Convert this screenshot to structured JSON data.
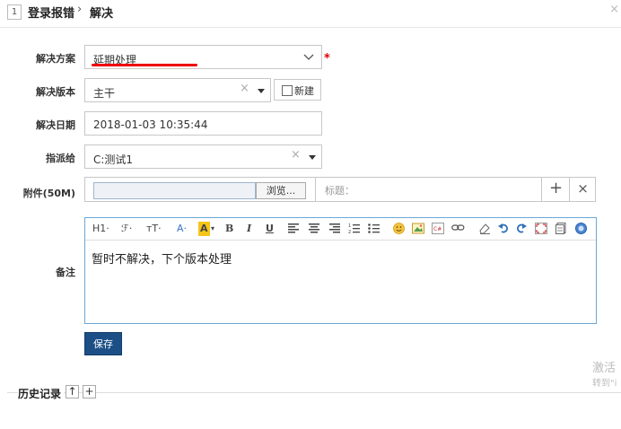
{
  "header": {
    "id": "1",
    "title": "登录报错",
    "separator": "›",
    "action": "解决",
    "close": "×"
  },
  "form": {
    "resolution": {
      "label": "解决方案",
      "value": "延期处理",
      "required_mark": "*"
    },
    "version": {
      "label": "解决版本",
      "value": "主干",
      "new_label": "新建"
    },
    "date": {
      "label": "解决日期",
      "value": "2018-01-03 10:35:44"
    },
    "assignee": {
      "label": "指派给",
      "value": "C:测试1"
    },
    "attachment": {
      "label": "附件(50M)",
      "browse": "浏览...",
      "title_placeholder": "标题：",
      "add": "+",
      "remove": "×"
    },
    "remark": {
      "label": "备注",
      "content": "暂时不解决，下个版本处理"
    }
  },
  "toolbar": {
    "heading": "H1·",
    "font_family": "ℱ·",
    "font_size": "тT·",
    "font_color": "A·",
    "bg_color": "A",
    "bold": "B",
    "italic": "I",
    "underline": "U"
  },
  "save_label": "保存",
  "history": {
    "label": "历史记录",
    "up": "↑",
    "expand": "+"
  },
  "watermark": {
    "line1": "激活",
    "line2": "转到\"i"
  },
  "colors": {
    "accent": "#1b4f86",
    "required": "#dd0000",
    "highlight": "#f5c518",
    "underline": "#e00000"
  }
}
